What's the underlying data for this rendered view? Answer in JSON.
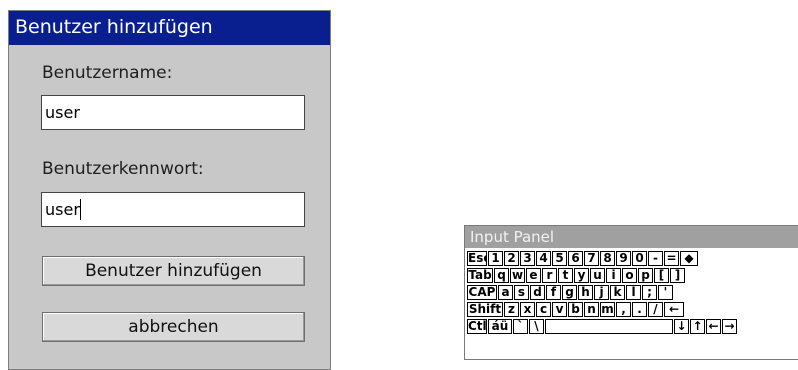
{
  "dialog": {
    "title": "Benutzer hinzufügen",
    "username_label": "Benutzername:",
    "username_value": "user",
    "password_label": "Benutzerkennwort:",
    "password_value": "user",
    "add_button_label": "Benutzer hinzufügen",
    "cancel_button_label": "abbrechen"
  },
  "input_panel": {
    "title": "Input Panel",
    "rows": [
      [
        "Esc",
        "1",
        "2",
        "3",
        "4",
        "5",
        "6",
        "7",
        "8",
        "9",
        "0",
        "-",
        "=",
        "◆"
      ],
      [
        "Tab",
        "q",
        "w",
        "e",
        "r",
        "t",
        "y",
        "u",
        "i",
        "o",
        "p",
        "[",
        "]"
      ],
      [
        "CAP",
        "a",
        "s",
        "d",
        "f",
        "g",
        "h",
        "j",
        "k",
        "l",
        ";",
        "'"
      ],
      [
        "Shift",
        "z",
        "x",
        "c",
        "v",
        "b",
        "n",
        "m",
        ",",
        ".",
        "/",
        "←"
      ],
      [
        "Ctl",
        "áü",
        "`",
        "\\",
        "",
        "↓",
        "↑",
        "←",
        "→"
      ]
    ]
  }
}
